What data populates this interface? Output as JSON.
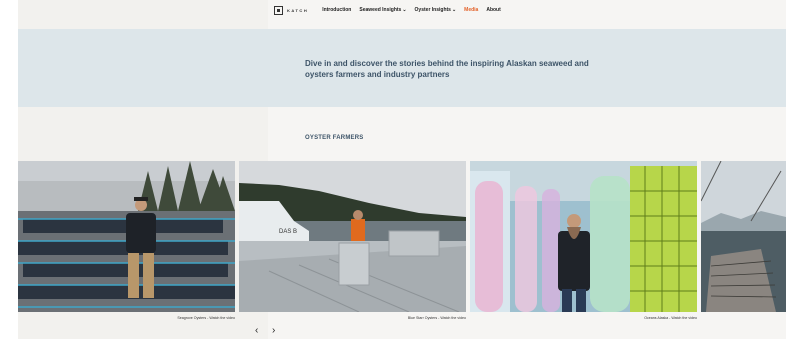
{
  "nav": {
    "logo_text": "KATCH",
    "items": [
      {
        "label": "Introduction",
        "dropdown": false,
        "active": false
      },
      {
        "label": "Seaweed Insights",
        "dropdown": true,
        "active": false
      },
      {
        "label": "Oyster Insights",
        "dropdown": true,
        "active": false
      },
      {
        "label": "Media",
        "dropdown": false,
        "active": true
      },
      {
        "label": "About",
        "dropdown": false,
        "active": false
      }
    ],
    "dropdown_icon": "chevron-down-icon",
    "active_color": "#e3622a"
  },
  "hero": {
    "text": "Dive in and discover the stories behind the inspiring Alaskan seaweed and oysters farmers and industry partners"
  },
  "section": {
    "title": "OYSTER FARMERS"
  },
  "videos": [
    {
      "caption": "Seagrove Oysters - Watch the video"
    },
    {
      "caption": "Blue Starr Oysters - Watch the video"
    },
    {
      "caption": "Oceans Alaska - Watch the video"
    },
    {
      "caption": ""
    }
  ],
  "carousel": {
    "prev_icon": "chevron-left-icon",
    "next_icon": "chevron-right-icon",
    "prev_glyph": "‹",
    "next_glyph": "›"
  },
  "colors": {
    "hero_band": "#dde6ea",
    "heading_text": "#3d5468",
    "background": "#f6f5f3"
  }
}
